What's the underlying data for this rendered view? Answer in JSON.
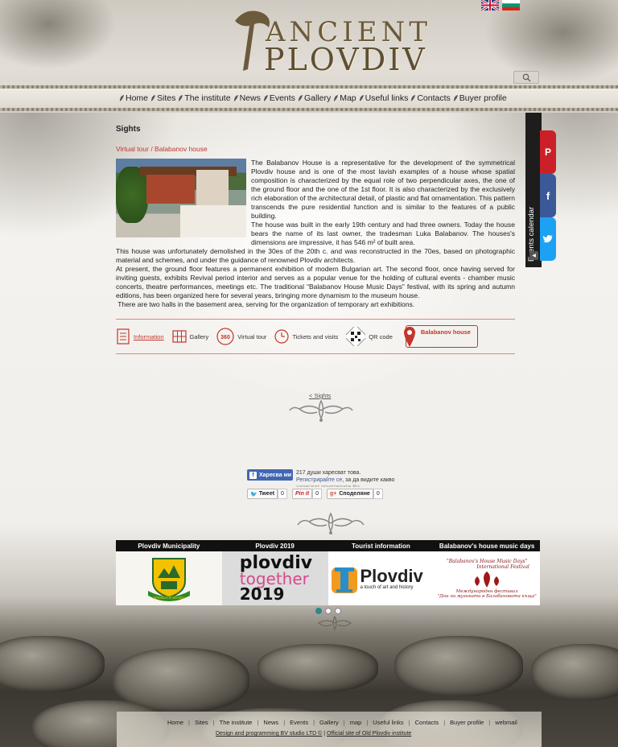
{
  "header": {
    "logo_line1": "ANCIENT",
    "logo_line2": "PLOVDIV",
    "languages": [
      "English",
      "Bulgarian"
    ]
  },
  "nav": {
    "items": [
      "Home",
      "Sites",
      "The institute",
      "News",
      "Events",
      "Gallery",
      "Map",
      "Useful links",
      "Contacts",
      "Buyer profile"
    ]
  },
  "page": {
    "section_title": "Sights",
    "breadcrumb": {
      "parent": "Virtual tour",
      "separator": " / ",
      "current": "Balabanov house"
    },
    "paragraphs": [
      "The Balabanov House is a representative for the development of the symmetrical Plovdiv house and is one of the most lavish examples of a house whose spatial composition is characterized by the equal role of two perpendicular axes, the one of the ground floor and the one of the 1st floor. It is also characterized by the exclusively rich elaboration of the architectural detail, of plastic and flat ornamentation. This pattern transcends the pure residential function and is similar to the features of a public building.",
      "The house was built in the early 19th century and had three owners. Today the house bears the name of its last owner, the tradesman Luka Balabanov. The houses's dimensions are impressive, it has 546 m² of built area.",
      "This house was unfortunately demolished in the 30es of the 20th c. and was reconstructed in the 70es, based on photographic material and schemes, and under the guidance of renowned Plovdiv architects.",
      "At present, the ground floor features a permanent exhibition of modern Bulgarian art. The second floor, once having served for inviting guests, exhibits Revival period interior and serves as a popular venue for the holding of cultural events - chamber music concerts, theatre performances, meetings etc. The traditional “Balabanov House Music Days” festival, with its spring and autumn editions, has been organized here for several years, bringing more dynamism to the museum house.",
      " There are two halls in the basement area, serving for the organization of temporary art exhibitions."
    ],
    "tabs": {
      "information": "Information",
      "gallery": "Gallery",
      "virtual_tour": "Virtual tour",
      "tickets": "Tickets and visits",
      "qr": "QR code",
      "location": "Balabanov house"
    },
    "back_link": "< Sights"
  },
  "social": {
    "fb_button": "Харесва ми",
    "fb_count_text": "217 души харесват това.",
    "fb_register": "Регистрирайте се",
    "fb_register_rest": ", за да видите какво",
    "fb_faded": "харесват приятелите Ви.",
    "tweet": "Tweet",
    "tweet_count": "0",
    "pin": "Pin it",
    "pin_count": "0",
    "gplus": "Споделяне",
    "gplus_count": "0"
  },
  "banners": [
    {
      "title": "Plovdiv Municipality",
      "caption": "ДРЕВЕН И ВЕЧЕН"
    },
    {
      "title": "Plovdiv 2019",
      "line1": "plovdiv",
      "line2": "together",
      "line3": "2019"
    },
    {
      "title": "Tourist information",
      "brand": "Plovdiv",
      "tagline": "a touch of art and history"
    },
    {
      "title": "Balabanov's house music days",
      "line1": "\"Balabanov's House Music Days\"",
      "line2": "International Festival",
      "line3": "Международен фестивал",
      "line4": "\"Дни на музиката в Балабановата къща\""
    }
  ],
  "side_widget": {
    "label": "Events calendar"
  },
  "footer": {
    "links": [
      "Home",
      "Sites",
      "The institute",
      "News",
      "Events",
      "Gallery",
      "map",
      "Useful links",
      "Contacts",
      "Buyer profile",
      "webmail"
    ],
    "credit_left": "Design and programming BV studio LTD ©",
    "credit_sep": " | ",
    "credit_right": "Official site of Old Plovdiv institute"
  }
}
